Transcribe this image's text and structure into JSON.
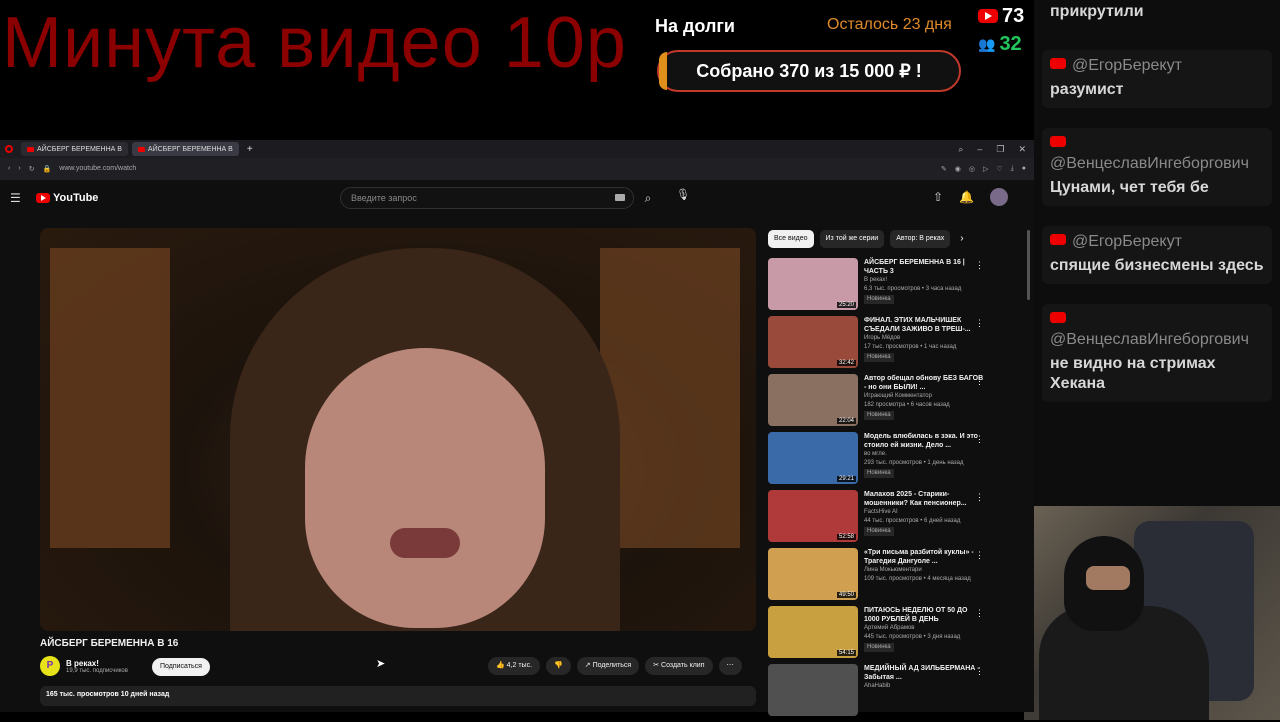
{
  "overlay": {
    "title": "Минута видео 10р",
    "donation": {
      "label": "На долги",
      "days_left": "Осталось 23 дня",
      "collected": "Собрано 370  из 15 000 ₽ !",
      "progress_fraction": 0.025
    },
    "stats": {
      "viewers": "73",
      "followers": "32"
    }
  },
  "chat": {
    "messages": [
      {
        "nick": "",
        "text": "прикрутили"
      },
      {
        "nick": "@ЕгорБерекут",
        "text": "разумист"
      },
      {
        "nick": "@ВенцеславИнгеборгович",
        "text": "Цунами, чет тебя бе"
      },
      {
        "nick": "@ЕгорБерекут",
        "text": "спящие бизнесмены здесь"
      },
      {
        "nick": "@ВенцеславИнгеборгович",
        "text": "не видно на стримах Хекана"
      }
    ]
  },
  "browser": {
    "tabs": [
      "АЙСБЕРГ БЕРЕМЕННА В",
      "АЙСБЕРГ БЕРЕМЕННА В"
    ],
    "url": "www.youtube.com/watch"
  },
  "youtube": {
    "logo": "YouTube",
    "search_placeholder": "Введите запрос",
    "video_title": "АЙСБЕРГ БЕРЕМЕННА В 16",
    "channel": "В реках!",
    "subscribers": "19,9 тыс. подписчиков",
    "subscribe": "Подписаться",
    "likes": "4,2 тыс.",
    "share": "Поделиться",
    "clip": "Создать клип",
    "description": "165 тыс. просмотров  10 дней назад",
    "chips": [
      "Все видео",
      "Из той же серии",
      "Автор: В реках"
    ],
    "recs": [
      {
        "title": "АЙСБЕРГ БЕРЕМЕННА В 16 | ЧАСТЬ 3",
        "channel": "В реках!",
        "meta": "6,3 тыс. просмотров • 3 часа назад",
        "badge": "Новинка",
        "dur": "25:20",
        "color": "#c89aa8"
      },
      {
        "title": "ФИНАЛ. ЭТИХ МАЛЬЧИШЕК СЪЕДАЛИ ЗАЖИВО В ТРЕШ-...",
        "channel": "Игорь Мёдов",
        "meta": "17 тыс. просмотров • 1 час назад",
        "badge": "Новинка",
        "dur": "32:42",
        "color": "#9a4a3a"
      },
      {
        "title": "Автор обещал обнову БЕЗ БАГОВ - но они БЫЛИ! ...",
        "channel": "Играющий Комментатор",
        "meta": "182 просмотра • 6 часов назад",
        "badge": "Новинка",
        "dur": "22:04",
        "color": "#8a7060"
      },
      {
        "title": "Модель влюбилась в зэка. И это стоило ей жизни. Дело ...",
        "channel": "во мгле.",
        "meta": "293 тыс. просмотров • 1 день назад",
        "badge": "Новинка",
        "dur": "29:21",
        "color": "#3a6aa8"
      },
      {
        "title": "Малахов 2025 - Старики-мошенники? Как пенсионер...",
        "channel": "FactsHive AI",
        "meta": "44 тыс. просмотров • 6 дней назад",
        "badge": "Новинка",
        "dur": "52:58",
        "color": "#b03a3a"
      },
      {
        "title": "«Три письма разбитой куклы» - Трагедия Дангуоле ...",
        "channel": "Лина Мокьюментари",
        "meta": "109 тыс. просмотров • 4 месяца назад",
        "badge": "",
        "dur": "49:50",
        "color": "#d0a050"
      },
      {
        "title": "ПИТАЮСЬ НЕДЕЛЮ ОТ 50 ДО 1000 РУБЛЕЙ В ДЕНЬ",
        "channel": "Артемий Абрамов",
        "meta": "445 тыс. просмотров • 3 дня назад",
        "badge": "Новинка",
        "dur": "54:15",
        "color": "#c8a040"
      },
      {
        "title": "МЕДИЙНЫЙ АД ЗИЛЬБЕРМАНА - Забытая ...",
        "channel": "AhaHabib",
        "meta": "",
        "badge": "",
        "dur": "",
        "color": "#505050"
      }
    ]
  }
}
